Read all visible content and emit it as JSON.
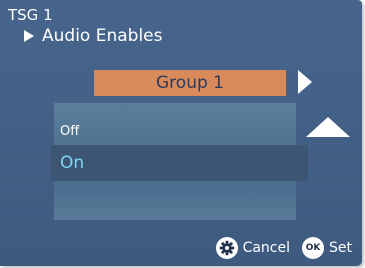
{
  "header": {
    "title": "TSG 1",
    "subtitle": "Audio Enables"
  },
  "group_selector": {
    "value": "Group 1"
  },
  "options": {
    "items": [
      "Off",
      "On"
    ],
    "selected": "On"
  },
  "footer": {
    "cancel_label": "Cancel",
    "ok_badge": "OK",
    "set_label": "Set"
  },
  "colors": {
    "panel_bg": "#47658c",
    "group_box": "#d98a5b",
    "selected_row": "#3b5573",
    "selected_text": "#7fd7f3"
  }
}
